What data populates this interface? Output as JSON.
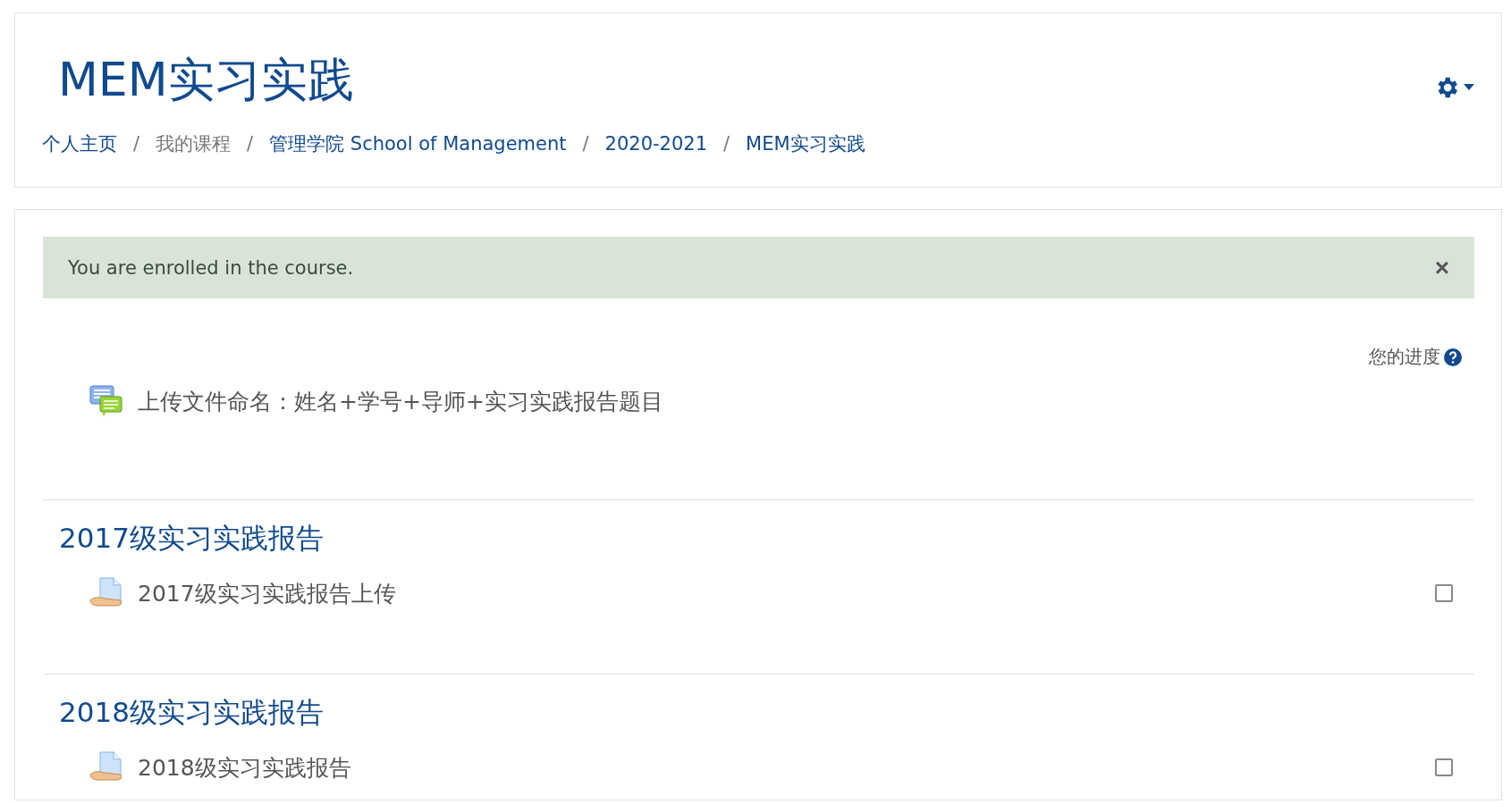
{
  "header": {
    "title": "MEM实习实践",
    "separator": "/",
    "breadcrumb": [
      {
        "label": "个人主页",
        "kind": "link"
      },
      {
        "label": "我的课程",
        "kind": "text"
      },
      {
        "label": "管理学院 School of Management",
        "kind": "link"
      },
      {
        "label": "2020-2021",
        "kind": "link"
      },
      {
        "label": "MEM实习实践",
        "kind": "link"
      }
    ]
  },
  "alert": {
    "message": "You are enrolled in the course.",
    "close": "×"
  },
  "progress_label": "您的进度",
  "notice": "上传文件命名：姓名+学号+导师+实习实践报告题目",
  "sections": [
    {
      "title": "2017级实习实践报告",
      "activities": [
        {
          "name": "2017级实习实践报告上传",
          "checked": false
        }
      ]
    },
    {
      "title": "2018级实习实践报告",
      "activities": [
        {
          "name": "2018级实习实践报告",
          "checked": false
        }
      ]
    }
  ]
}
